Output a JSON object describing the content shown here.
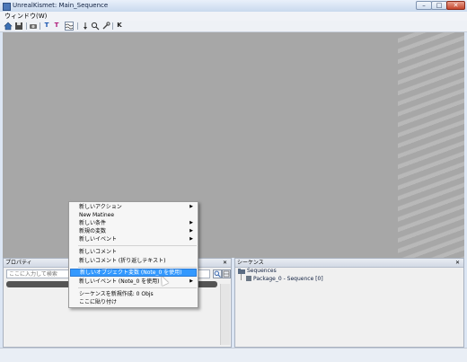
{
  "window": {
    "title": "UnrealKismet: Main_Sequence",
    "minimize": "–",
    "maximize": "□",
    "close": "✕"
  },
  "menubar": {
    "items": [
      "ウィンドウ(W)"
    ]
  },
  "toolbar": {
    "icons": [
      "home-icon",
      "save-icon",
      "open-icon",
      "text-t-icon",
      "text-tt-icon",
      "wave-icon",
      "down-arrow-icon",
      "search-icon",
      "tool-icon",
      "k-icon"
    ]
  },
  "properties_panel": {
    "title": "プロパティ",
    "close": "✕",
    "search": {
      "value": "",
      "placeholder": "ここに入力して検索"
    }
  },
  "sequences_panel": {
    "title": "シーケンス",
    "close": "✕",
    "root": "Sequences",
    "child": "Package_0 - Sequence [0]"
  },
  "context_menu": {
    "items": [
      {
        "label": "新しいアクション",
        "submenu": true
      },
      {
        "label": "New Matinee",
        "submenu": false
      },
      {
        "label": "新しい条件",
        "submenu": true
      },
      {
        "label": "新規の変数",
        "submenu": true
      },
      {
        "label": "新しいイベント",
        "submenu": true
      },
      {
        "label": "新しいコメント",
        "submenu": false
      },
      {
        "label": "新しいコメント (折り返しテキスト)",
        "submenu": false
      },
      {
        "label": "新しいオブジェクト変数 (Note_0 を使用)",
        "submenu": false,
        "highlighted": true
      },
      {
        "label": "新しいイベント (Note_0 を使用)",
        "submenu": true
      },
      {
        "label": "シーケンスを新規作成: 0 Objs",
        "submenu": false
      },
      {
        "label": "ここに貼り付け",
        "submenu": false
      }
    ],
    "submenu_arrow": "▶"
  },
  "colors": {
    "canvas": "#a7a7a7",
    "highlight": "#3399ff"
  }
}
